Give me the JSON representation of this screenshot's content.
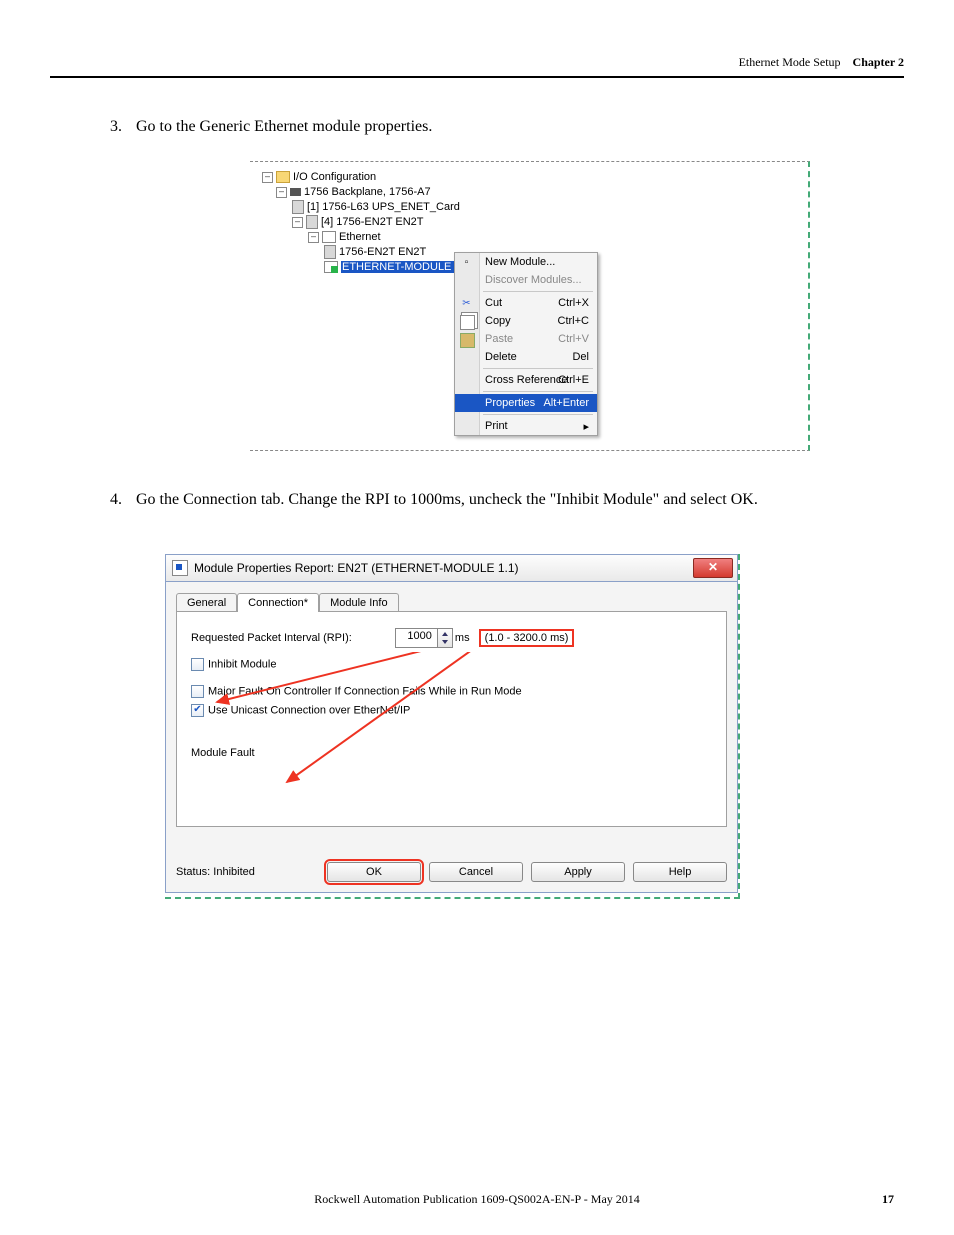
{
  "header": {
    "section": "Ethernet Mode Setup",
    "chapter": "Chapter 2"
  },
  "step3": {
    "num": "3.",
    "text": "Go to the Generic Ethernet module properties."
  },
  "tree": {
    "root": "I/O Configuration",
    "backplane": "1756 Backplane, 1756-A7",
    "slot1": "[1] 1756-L63 UPS_ENET_Card",
    "slot4": "[4] 1756-EN2T EN2T",
    "ethernet": "Ethernet",
    "en2t": "1756-EN2T EN2T",
    "selected": "ETHERNET-MODULE ENET_Card"
  },
  "ctx": {
    "new_module": "New Module...",
    "discover": "Discover Modules...",
    "cut": "Cut",
    "cut_sc": "Ctrl+X",
    "copy": "Copy",
    "copy_sc": "Ctrl+C",
    "paste": "Paste",
    "paste_sc": "Ctrl+V",
    "delete": "Delete",
    "delete_sc": "Del",
    "xref": "Cross Reference",
    "xref_sc": "Ctrl+E",
    "props": "Properties",
    "props_sc": "Alt+Enter",
    "print": "Print",
    "print_arrow": "▸"
  },
  "step4": {
    "num": "4.",
    "text": "Go the Connection tab. Change the RPI to 1000ms, uncheck the \"Inhibit Module\" and select OK."
  },
  "dlg": {
    "title": "Module Properties Report: EN2T (ETHERNET-MODULE 1.1)",
    "tab_general": "General",
    "tab_connection": "Connection*",
    "tab_modinfo": "Module Info",
    "rpi_label": "Requested Packet Interval (RPI):",
    "rpi_value": "1000",
    "rpi_unit": "ms",
    "rpi_range": "(1.0 - 3200.0 ms)",
    "chk_inhibit": "Inhibit Module",
    "chk_major": "Major Fault On Controller If Connection Fails While in Run Mode",
    "chk_unicast": "Use Unicast Connection over EtherNet/IP",
    "fault_label": "Module Fault",
    "status": "Status: Inhibited",
    "ok": "OK",
    "cancel": "Cancel",
    "apply": "Apply",
    "help": "Help"
  },
  "footer": {
    "pub": "Rockwell Automation Publication 1609-QS002A-EN-P - May 2014",
    "page": "17"
  }
}
